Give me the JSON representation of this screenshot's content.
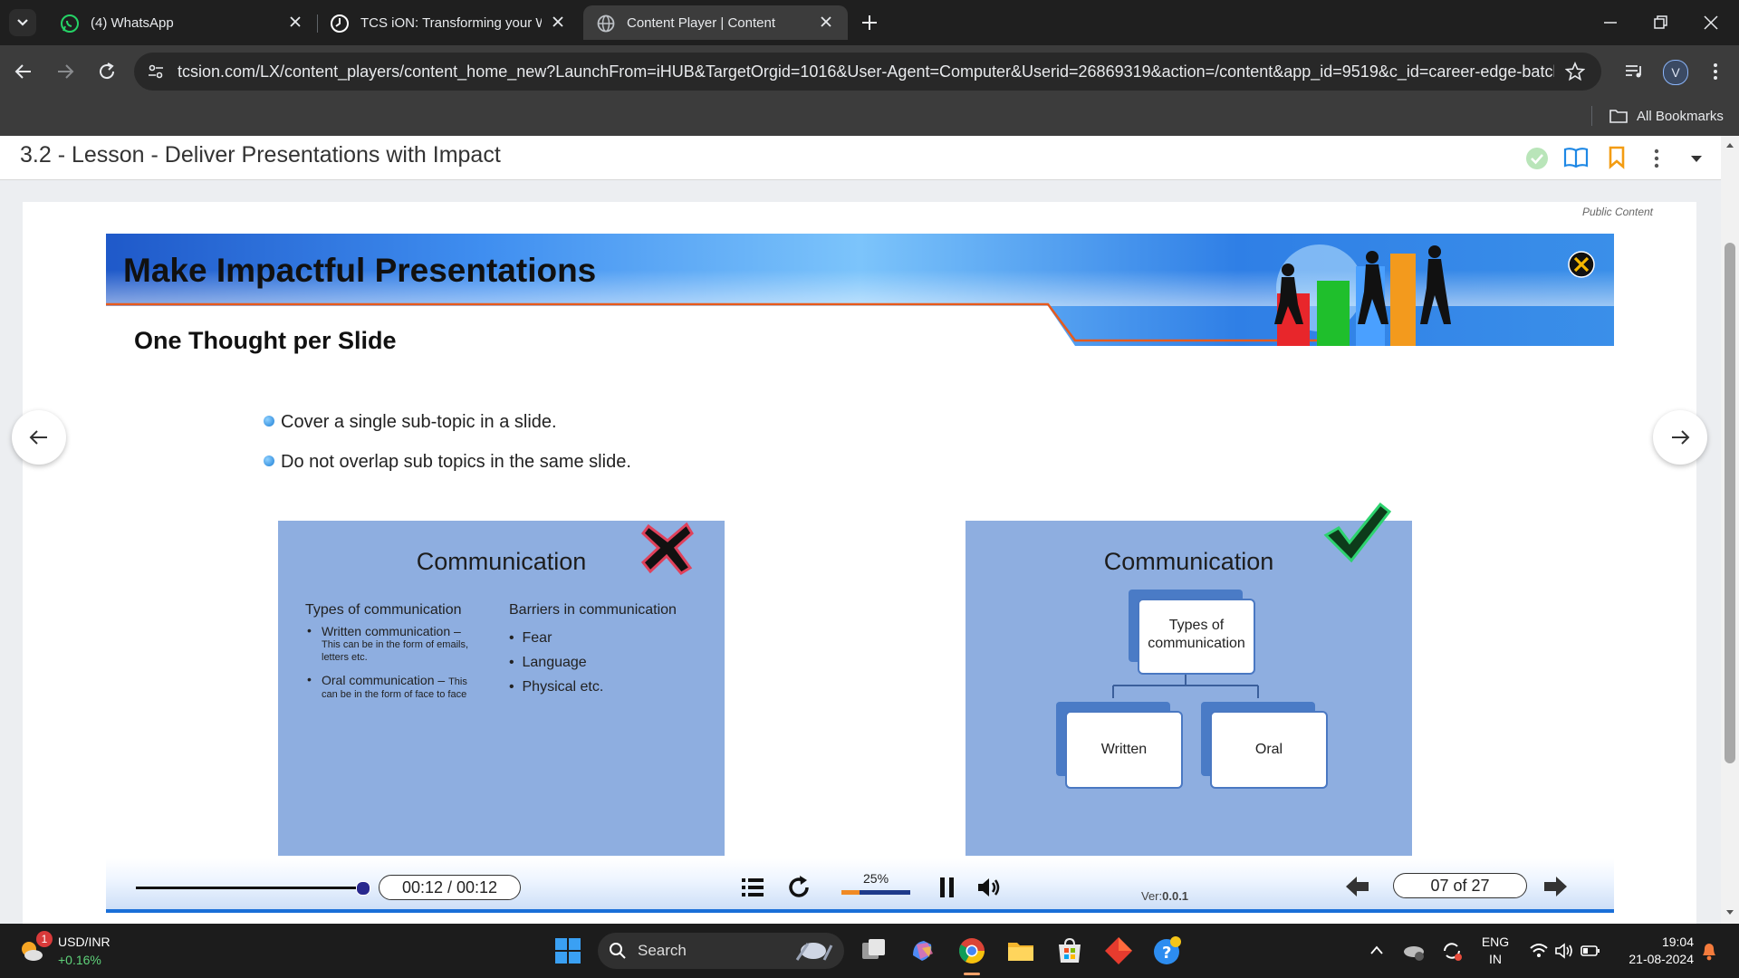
{
  "browser": {
    "tabs": [
      {
        "label": "(4) WhatsApp",
        "icon": "whatsapp-icon",
        "active": false
      },
      {
        "label": "TCS iON: Transforming your Wo",
        "icon": "tcs-ion-icon",
        "active": false
      },
      {
        "label": "Content Player | Content",
        "icon": "globe-icon",
        "active": true
      }
    ],
    "url": "tcsion.com/LX/content_players/content_home_new?LaunchFrom=iHUB&TargetOrgid=1016&User-Agent=Computer&Userid=26869319&action=/content&app_id=9519&c_id=career-edge-batch...",
    "profile_initial": "V",
    "bookmarks_label": "All Bookmarks"
  },
  "lesson": {
    "title": "3.2 - Lesson - Deliver Presentations with Impact",
    "public_label": "Public Content"
  },
  "slide": {
    "title": "Make Impactful Presentations",
    "subtitle": "One Thought per Slide",
    "bullets": [
      "Cover a single sub-topic in a slide.",
      "Do not overlap sub topics in the same slide."
    ],
    "bad_example": {
      "title": "Communication",
      "left_heading": "Types of communication",
      "left_items": [
        {
          "main": "Written communication –",
          "detail": "This can be in the form of emails, letters etc."
        },
        {
          "main": "Oral communication – ",
          "detail_inline": "This",
          "detail": "can be in the form of  face to face"
        }
      ],
      "right_heading": "Barriers in communication",
      "right_items": [
        "Fear",
        "Language",
        "Physical etc."
      ]
    },
    "good_example": {
      "title": "Communication",
      "root": "Types of communication",
      "children": [
        "Written",
        "Oral"
      ]
    }
  },
  "player": {
    "time": "00:12 / 00:12",
    "progress": 1.0,
    "speed": "25%",
    "version_prefix": "Ver:",
    "version": "0.0.1",
    "page": "07 of 27"
  },
  "taskbar": {
    "weather_badge": "1",
    "ticker_name": "USD/INR",
    "ticker_change": "+0.16%",
    "search_label": "Search",
    "lang_top": "ENG",
    "lang_bottom": "IN",
    "time": "19:04",
    "date": "21-08-2024"
  }
}
